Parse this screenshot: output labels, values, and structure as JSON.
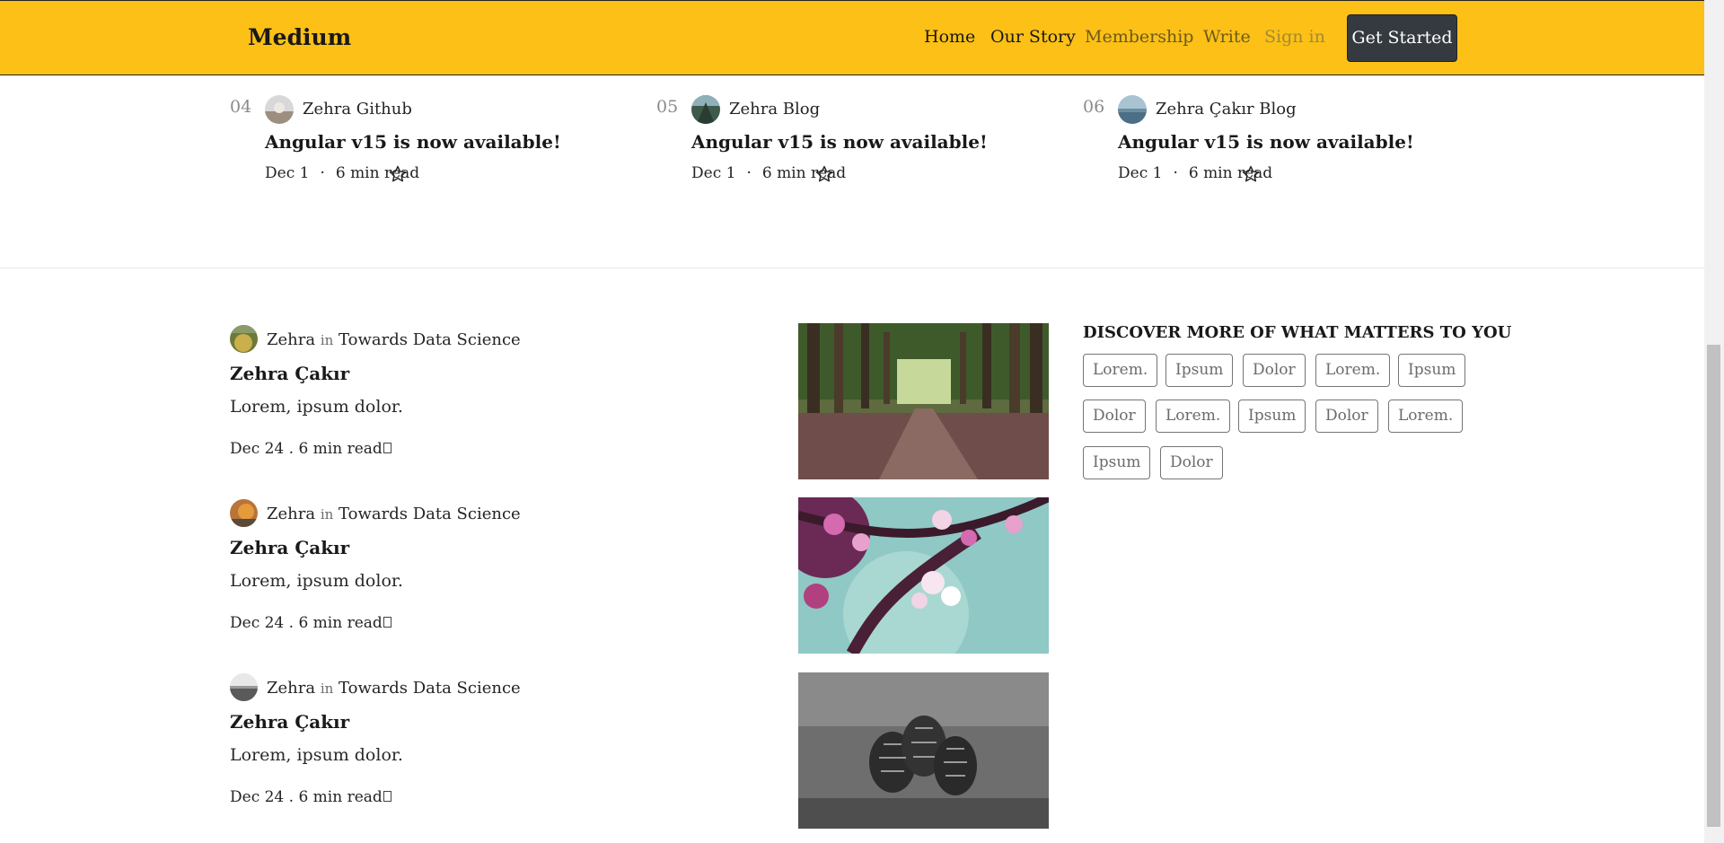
{
  "header": {
    "logo": "Medium",
    "nav": {
      "home": "Home",
      "our_story": "Our Story",
      "membership": "Membership",
      "write": "Write",
      "sign_in": "Sign in"
    },
    "cta": "Get Started",
    "bg_color": "#fcc017"
  },
  "trending": [
    {
      "number": "04",
      "author": "Zehra Github",
      "title": "Angular v15 is now available!",
      "date": "Dec 1",
      "separator": "·",
      "read_time": "6 min read"
    },
    {
      "number": "05",
      "author": "Zehra Blog",
      "title": "Angular v15 is now available!",
      "date": "Dec 1",
      "separator": "·",
      "read_time": "6 min read"
    },
    {
      "number": "06",
      "author": "Zehra Çakır Blog",
      "title": "Angular v15 is now available!",
      "date": "Dec 1",
      "separator": "·",
      "read_time": "6 min read"
    }
  ],
  "posts": [
    {
      "author": "Zehra",
      "in_label": "in",
      "publication": "Towards Data Science",
      "title": "Zehra Çakır",
      "excerpt": "Lorem, ipsum dolor.",
      "meta": "Dec 24 .   6 min read",
      "image": "forest-path"
    },
    {
      "author": "Zehra",
      "in_label": "in",
      "publication": "Towards Data Science",
      "title": "Zehra Çakır",
      "excerpt": "Lorem, ipsum dolor.",
      "meta": "Dec 24 .   6 min read",
      "image": "cherry-blossom"
    },
    {
      "author": "Zehra",
      "in_label": "in",
      "publication": "Towards Data Science",
      "title": "Zehra Çakır",
      "excerpt": "Lorem, ipsum dolor.",
      "meta": "Dec 24 .   6 min read",
      "image": "pine-cones"
    }
  ],
  "discover": {
    "title": "DISCOVER MORE OF WHAT MATTERS TO YOU",
    "tags": [
      "Lorem.",
      "Ipsum",
      "Dolor",
      "Lorem.",
      "Ipsum",
      "Dolor",
      "Lorem.",
      "Ipsum",
      "Dolor",
      "Lorem.",
      "Ipsum",
      "Dolor"
    ]
  }
}
